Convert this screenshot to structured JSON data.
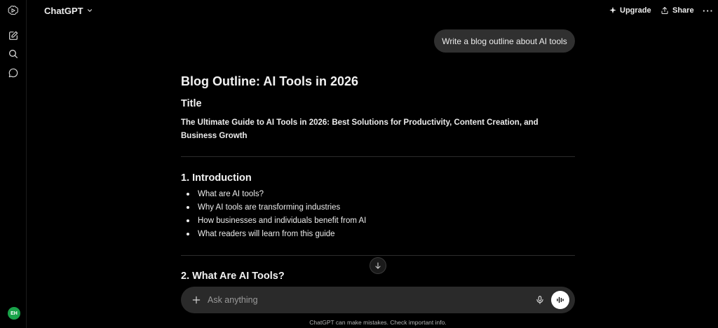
{
  "header": {
    "model_name": "ChatGPT",
    "upgrade_label": "Upgrade",
    "share_label": "Share",
    "more_label": "···"
  },
  "sidebar": {
    "icons": [
      "openai-logo-icon",
      "new-chat-icon",
      "search-icon",
      "chat-bubble-icon"
    ],
    "avatar_initials": "EH",
    "avatar_color": "#19a34a"
  },
  "conversation": {
    "user_message": "Write a blog outline about AI tools",
    "response": {
      "heading": "Blog Outline: AI Tools in 2026",
      "title_heading": "Title",
      "title_text": "The Ultimate Guide to AI Tools in 2026: Best Solutions for Productivity, Content Creation, and Business Growth",
      "section1_heading": "1. Introduction",
      "section1_bullets": [
        "What are AI tools?",
        "Why AI tools are transforming industries",
        "How businesses and individuals benefit from AI",
        "What readers will learn from this guide"
      ],
      "section2_heading": "2. What Are AI Tools?"
    }
  },
  "composer": {
    "placeholder": "Ask anything"
  },
  "footer": {
    "disclaimer": "ChatGPT can make mistakes. Check important info."
  },
  "colors": {
    "background": "#000000",
    "bubble": "#303030",
    "composer": "#2a2a2a",
    "text": "#ececec"
  }
}
